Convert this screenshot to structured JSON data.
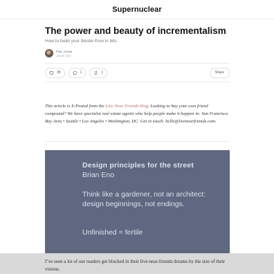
{
  "site": {
    "title": "Supernuclear"
  },
  "post": {
    "title": "The power and beauty of incrementalism",
    "subtitle": "How to build your Bestie Row in bits",
    "author": "PHIL LEVIN",
    "date": "JUN 25, 2022"
  },
  "actions": {
    "likes": "35",
    "comments": "1",
    "restacks": "1",
    "share_label": "Share",
    "icons": [
      "heart-icon",
      "comment-icon",
      "restack-icon"
    ]
  },
  "note": {
    "prefix": "This article is X-Posted from the ",
    "link_text": "Live Near Friends blog",
    "suffix": ". Looking to buy your own friend compound? We have specialist real estate agents who help people make it happen in: San Francisco Bay Area • Seattle • Los Angeles • Washington, DC. Get in touch: hello@livenearfriends.com."
  },
  "quote_card": {
    "heading": "Design principles for the street",
    "attribution": "Brian Eno",
    "body": "Think like a gardener, not an architect: design beginnings, not endings.",
    "tail": "Unfinished = fertile",
    "background": "#606781"
  },
  "body": {
    "paragraph": "I’ve seen a lot of our readers get blocked in their live-near-friends dreams by the size of their visions."
  }
}
